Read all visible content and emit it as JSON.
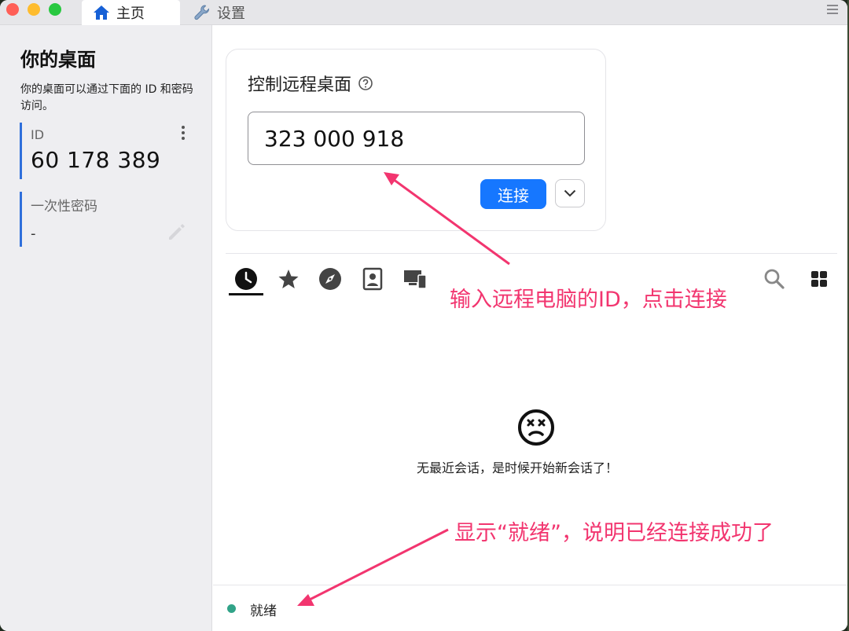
{
  "tabs": {
    "home": "主页",
    "settings": "设置"
  },
  "left_panel": {
    "title": "你的桌面",
    "description": "你的桌面可以通过下面的 ID 和密码访问。",
    "id_label": "ID",
    "id_value": "60 178 389",
    "password_label": "一次性密码",
    "password_value": "-"
  },
  "remote_card": {
    "title": "控制远程桌面",
    "id_input_value": "323 000 918",
    "connect_label": "连接"
  },
  "toolbar": {
    "icons": [
      "clock-icon",
      "star-icon",
      "compass-icon",
      "contact-card-icon",
      "devices-icon",
      "search-icon",
      "grid-icon"
    ]
  },
  "empty_state": {
    "message": "无最近会话，是时候开始新会话了！"
  },
  "status": {
    "text": "就绪",
    "dot_color": "#31a388"
  },
  "annotations": {
    "top": "输入远程电脑的ID，点击连接",
    "bottom": "显示“就绪”，说明已经连接成功了",
    "color": "#f2356f"
  },
  "colors": {
    "accent": "#1677ff",
    "id_bar": "#2f6fdb"
  }
}
